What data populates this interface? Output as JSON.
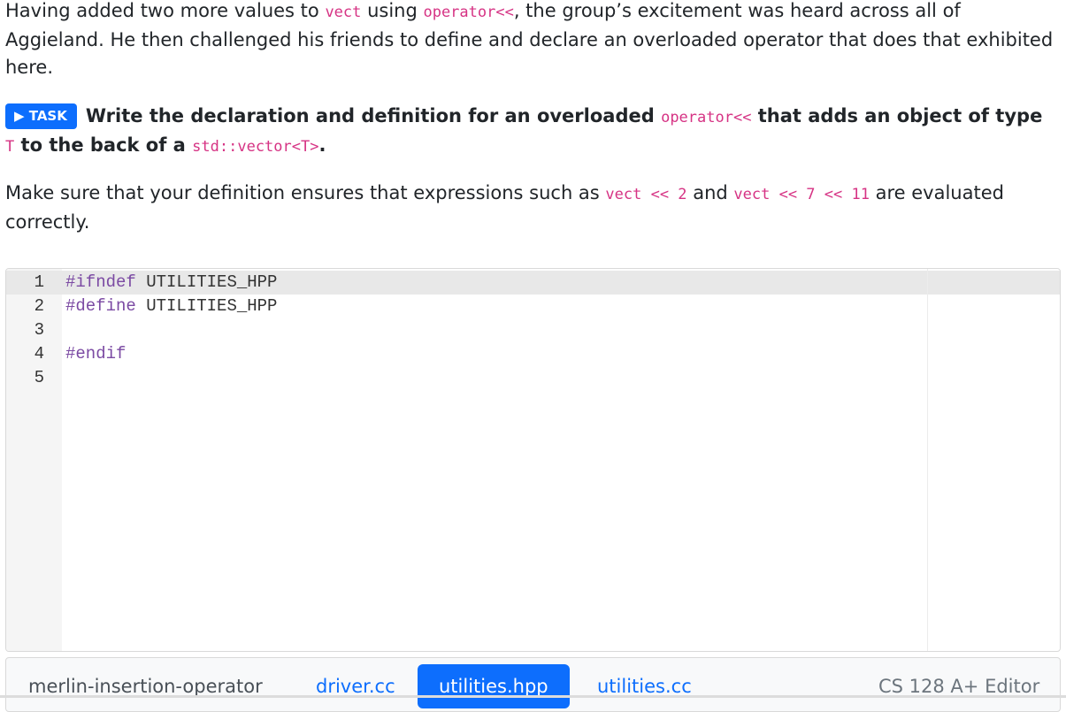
{
  "intro": {
    "t1": "Having added two more values to ",
    "c1": "vect",
    "t2": " using ",
    "c2": "operator<<",
    "t3": ", the group’s excitement was heard across all of Aggieland. He then challenged his friends to define and declare an overloaded operator that does that exhibited here."
  },
  "task": {
    "badge": "▶ TASK",
    "t1": "Write the declaration and definition for an overloaded ",
    "c1": "operator<<",
    "t2": " that adds an object of type ",
    "c2": "T",
    "t3": " to the back of a ",
    "c3": "std::vector<T>",
    "t4": "."
  },
  "note": {
    "t1": "Make sure that your definition ensures that expressions such as ",
    "c1": "vect << 2",
    "t2": " and ",
    "c2": "vect << 7 << 11",
    "t3": " are evaluated correctly."
  },
  "editor": {
    "lines": [
      {
        "num": "1",
        "kw": "#ifndef",
        "rest": " UTILITIES_HPP"
      },
      {
        "num": "2",
        "kw": "#define",
        "rest": " UTILITIES_HPP"
      },
      {
        "num": "3",
        "kw": "",
        "rest": ""
      },
      {
        "num": "4",
        "kw": "#endif",
        "rest": ""
      },
      {
        "num": "5",
        "kw": "",
        "rest": ""
      }
    ]
  },
  "tabs": {
    "project": "merlin-insertion-operator",
    "driver": "driver.cc",
    "utilities_hpp": "utilities.hpp",
    "utilities_cc": "utilities.cc",
    "brand": "CS 128 A+ Editor"
  },
  "colors": {
    "accent": "#0d6efd",
    "inline_code": "#d63384",
    "preprocessor": "#7b4aa3"
  }
}
